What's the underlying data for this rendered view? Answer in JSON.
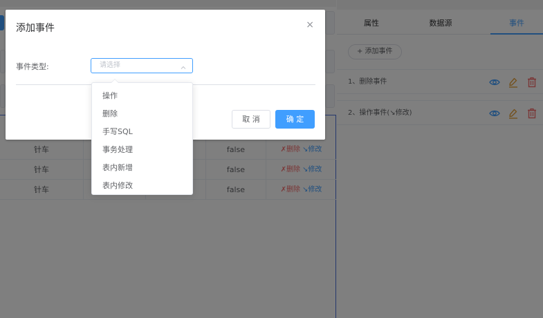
{
  "background": {
    "table_rows": [
      {
        "col1": "针车",
        "col4": "false",
        "delete": "✗删除",
        "edit": "↘修改"
      },
      {
        "col1": "针车",
        "col4": "false",
        "delete": "✗删除",
        "edit": "↘修改"
      },
      {
        "col1": "针车",
        "col4": "false",
        "delete": "✗删除",
        "edit": "↘修改"
      }
    ],
    "right_panel": {
      "tabs": [
        "属性",
        "数据源",
        "事件"
      ],
      "active_tab": "事件",
      "add_event_label": "+ 添加事件",
      "events": [
        {
          "label": "1、删除事件",
          "icons": [
            "eye-icon",
            "edit-icon",
            "delete-icon"
          ]
        },
        {
          "label": "2、操作事件(↘修改)",
          "icons": [
            "eye-icon",
            "edit-icon",
            "delete-icon"
          ]
        }
      ]
    }
  },
  "dialog": {
    "title": "添加事件",
    "close_symbol": "×",
    "field_label": "事件类型:",
    "select_placeholder": "请选择",
    "cancel_label": "取 消",
    "confirm_label": "确 定",
    "options": [
      "操作",
      "删除",
      "手写SQL",
      "事务处理",
      "表内新增",
      "表内修改"
    ]
  },
  "colors": {
    "primary": "#409eff",
    "danger": "#f56c6c",
    "icon_eye": "#409eff",
    "icon_edit": "#e6a23c",
    "icon_delete": "#f56c6c"
  }
}
